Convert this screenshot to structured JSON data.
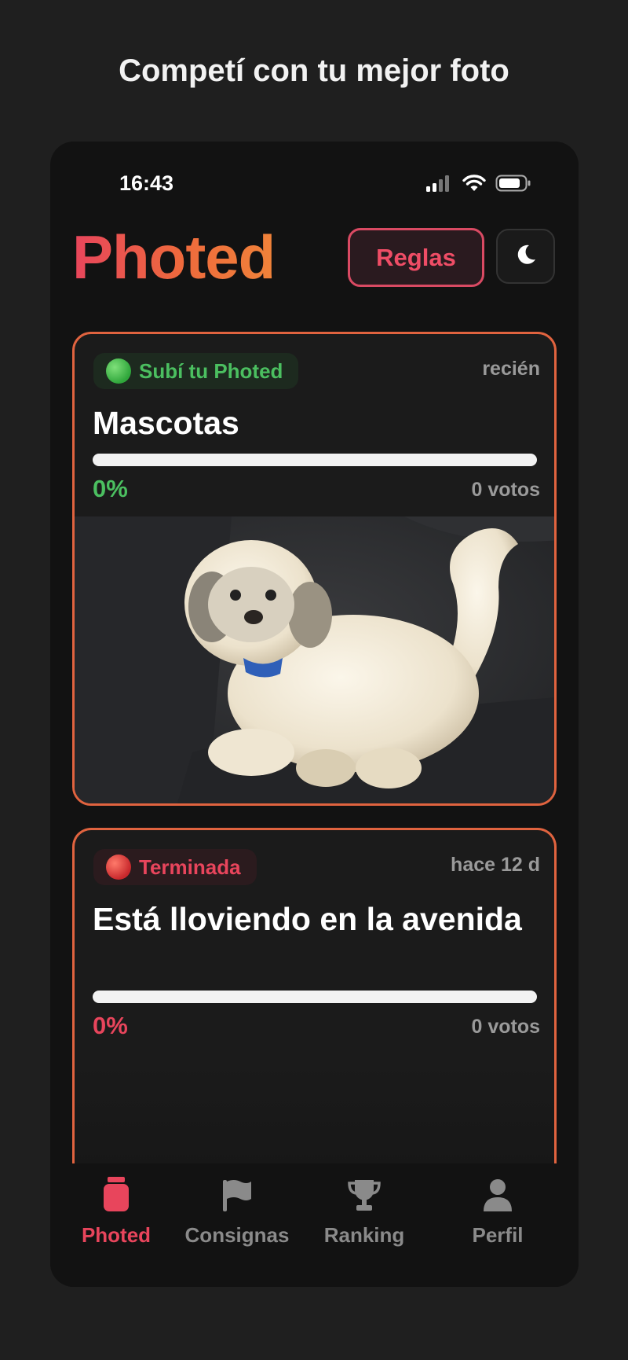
{
  "tagline": "Competí con tu mejor foto",
  "status_bar": {
    "time": "16:43",
    "icons": [
      "cellular-signal-icon",
      "wifi-icon",
      "battery-icon"
    ]
  },
  "header": {
    "logo": "Photed",
    "rules_button": "Reglas",
    "theme_toggle_icon": "moon-icon"
  },
  "cards": [
    {
      "status": "Subí tu Photed",
      "status_color": "#4bbf60",
      "time_ago": "recién",
      "title": "Mascotas",
      "progress": 0,
      "percent_label": "0%",
      "votes": "0 votos",
      "image": "white-dog-on-black-couch"
    },
    {
      "status": "Terminada",
      "status_color": "#e8455c",
      "time_ago": "hace 12 d",
      "title": "Está lloviendo en la avenida",
      "progress": 0,
      "percent_label": "0%",
      "votes": "0 votos"
    }
  ],
  "tabbar": {
    "items": [
      {
        "label": "Photed",
        "icon": "jar-icon",
        "active": true
      },
      {
        "label": "Consignas",
        "icon": "flag-icon",
        "active": false
      },
      {
        "label": "Ranking",
        "icon": "trophy-icon",
        "active": false
      },
      {
        "label": "Perfil",
        "icon": "person-icon",
        "active": false
      }
    ]
  },
  "colors": {
    "accent": "#e8455c",
    "card_border": "#e0633f",
    "success": "#4bbf60",
    "background": "#1f1f1f"
  }
}
